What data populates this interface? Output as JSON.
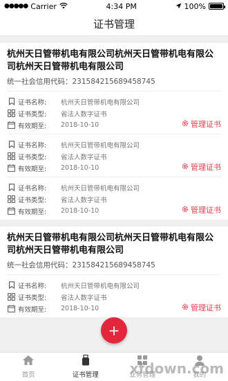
{
  "status_bar": {
    "carrier": "Carrier",
    "time": "4:34 PM",
    "battery": "100%",
    "battery_level": 1.0
  },
  "nav": {
    "title": "证书管理"
  },
  "companies": [
    {
      "name": "杭州天日管带机电有限公司杭州天日管带机电有限公司杭州天日管带机电有限公司",
      "credit_label": "统一社会信用代码：",
      "credit_code": "2315842156894587​45",
      "certs": [
        {
          "name_label": "证书名称:",
          "name": "杭州天日管带机电有限公司",
          "type_label": "证书类型:",
          "type": "省法人数字证书",
          "expiry_label": "有效期至:",
          "expiry": "2018-10-10",
          "manage": "管理证书"
        },
        {
          "name_label": "证书名称:",
          "name": "杭州天日管带机电有限公司",
          "type_label": "证书类型:",
          "type": "省法人数字证书",
          "expiry_label": "有效期至:",
          "expiry": "2018-10-10",
          "manage": "管理证书"
        },
        {
          "name_label": "证书名称:",
          "name": "杭州天日管带机电有限公司",
          "type_label": "证书类型:",
          "type": "省法人数字证书",
          "expiry_label": "有效期至:",
          "expiry": "2018-10-10",
          "manage": "管理证书"
        }
      ]
    },
    {
      "name": "杭州天日管带机电有限公司杭州天日管带机电有限公司杭州天日管带机电有限公司",
      "credit_label": "统一社会信用代码：",
      "credit_code": "231584215689458745",
      "certs": [
        {
          "name_label": "证书名称:",
          "name": "杭州天日管带机电有限公司",
          "type_label": "证书类型:",
          "type": "省法人数字证书",
          "expiry_label": "有效期至:",
          "expiry": "2018-10-10",
          "manage": "管理证书"
        }
      ]
    }
  ],
  "fab": {
    "label": "+"
  },
  "tabs": [
    {
      "label": "首页",
      "icon": "home-icon"
    },
    {
      "label": "证书管理",
      "icon": "usb-key-icon"
    },
    {
      "label": "业务管理",
      "icon": "apps-icon"
    },
    {
      "label": "我的",
      "icon": "user-icon"
    }
  ],
  "watermark": "xfdown.com",
  "colors": {
    "accent": "#e3263c",
    "manage_text": "#e33a4d"
  }
}
